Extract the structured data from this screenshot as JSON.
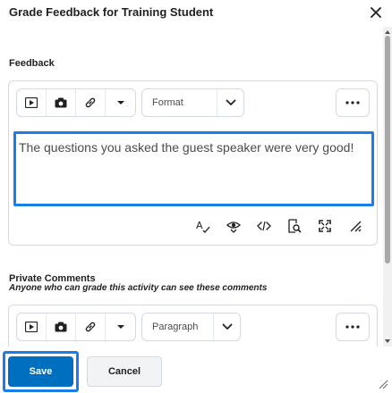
{
  "dialog": {
    "title": "Grade Feedback for Training Student"
  },
  "feedback": {
    "label": "Feedback",
    "format_select": "Format",
    "content": "The questions you asked the guest speaker were very good!"
  },
  "private_comments": {
    "label": "Private Comments",
    "sublabel": "Anyone who can grade this activity can see these comments",
    "format_select": "Paragraph"
  },
  "footer": {
    "save_label": "Save",
    "cancel_label": "Cancel"
  },
  "colors": {
    "primary": "#006fbf",
    "focus": "#1a7ee8"
  }
}
